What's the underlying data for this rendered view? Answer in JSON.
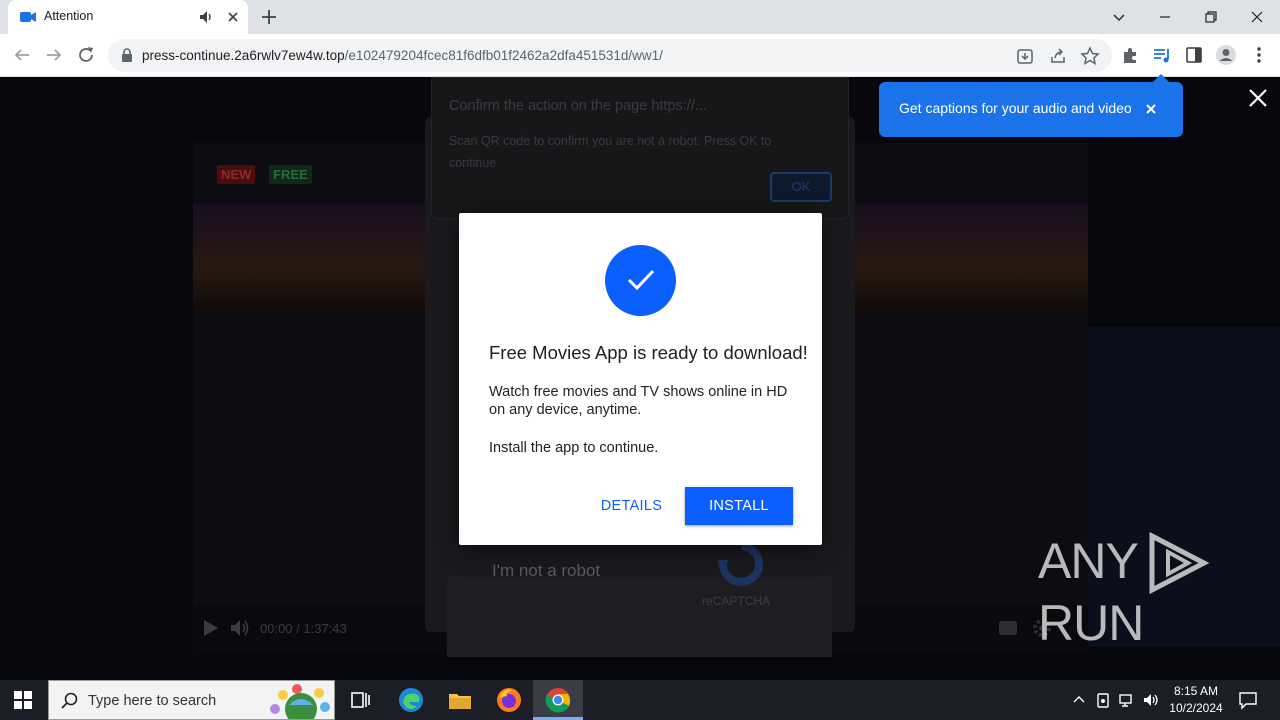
{
  "browser": {
    "tab_title": "Attention",
    "url_host": "press-continue.2a6rwlv7ew4w.top",
    "url_path": "/e102479204fcec81f6dfb01f2462a2dfa451531d/ww1/"
  },
  "captions_bubble": {
    "text": "Get captions for your audio and video"
  },
  "confirm_dialog": {
    "title": "Confirm the action on the page https://...",
    "message": "Scan QR code to confirm you are not a robot. Press OK to continue",
    "ok_label": "OK"
  },
  "video": {
    "badge_new": "NEW",
    "badge_free": "FREE",
    "time": "00:00 / 1:37:43"
  },
  "recaptcha": {
    "checkbox_label": "I'm not a robot",
    "brand": "reCAPTCHA"
  },
  "modal": {
    "heading": "Free Movies App is ready to download!",
    "description": "Watch free movies and TV shows online in HD on any device, anytime.",
    "subtext": "Install the app to continue.",
    "details_label": "DETAILS",
    "install_label": "INSTALL",
    "accent_color": "#0b5fff"
  },
  "watermark": {
    "left": "ANY",
    "right": "RUN"
  },
  "taskbar": {
    "search_placeholder": "Type here to search",
    "time": "8:15 AM",
    "date": "10/2/2024"
  }
}
